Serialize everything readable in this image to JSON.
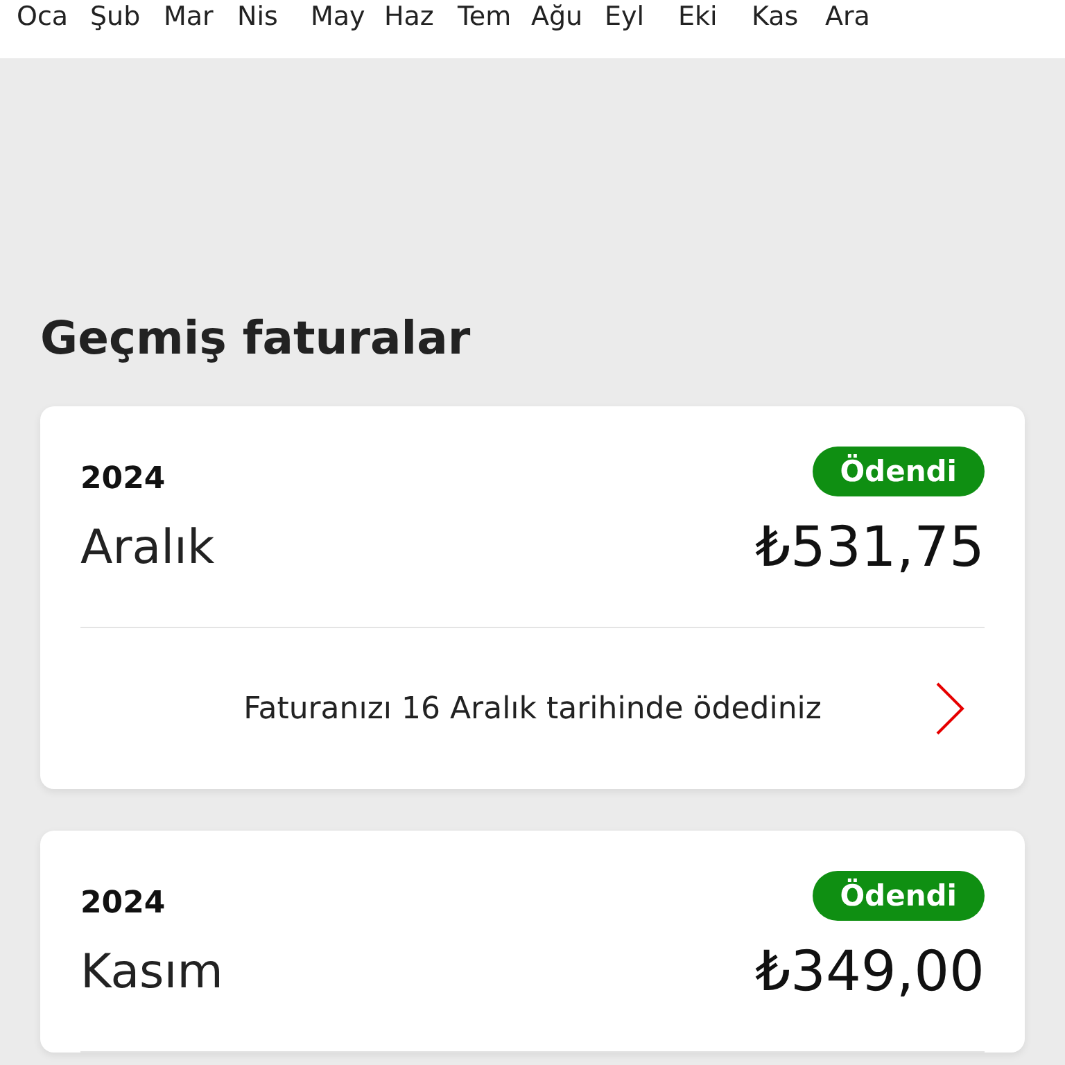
{
  "months": [
    "Oca",
    "Şub",
    "Mar",
    "Nis",
    "May",
    "Haz",
    "Tem",
    "Ağu",
    "Eyl",
    "Eki",
    "Kas",
    "Ara"
  ],
  "section_title": "Geçmiş faturalar",
  "bills": [
    {
      "year": "2024",
      "status": "Ödendi",
      "paid": true,
      "month": "Aralık",
      "amount": "₺531,75",
      "note": "Faturanızı 16 Aralık tarihinde ödediniz"
    },
    {
      "year": "2024",
      "status": "Ödendi",
      "paid": true,
      "month": "Kasım",
      "amount": "₺349,00"
    }
  ]
}
